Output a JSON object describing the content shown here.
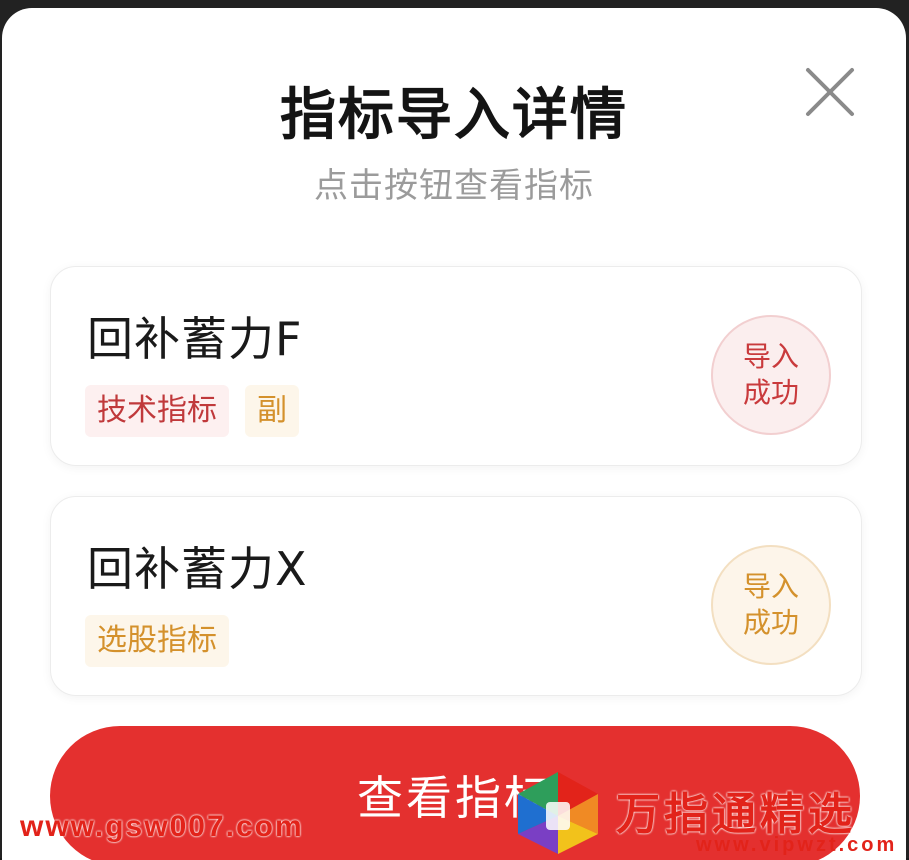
{
  "dialog": {
    "title": "指标导入详情",
    "subtitle": "点击按钮查看指标"
  },
  "cards": [
    {
      "name": "回补蓄力F",
      "tags": [
        "技术指标",
        "副"
      ],
      "status": "导入\n成功"
    },
    {
      "name": "回补蓄力X",
      "tags": [
        "选股指标"
      ],
      "status": "导入\n成功"
    }
  ],
  "primary_button": {
    "label": "查看指标"
  },
  "watermarks": {
    "left_url": "www.gsw007.com",
    "right_title": "万指通精选",
    "right_url": "www.vipwzt.com"
  },
  "icons": {
    "close": "close-icon",
    "logo": "logo-icon"
  },
  "colors": {
    "accent_red": "#e4302f",
    "tag_red": "#c0393b",
    "tag_orange": "#d4912c"
  }
}
